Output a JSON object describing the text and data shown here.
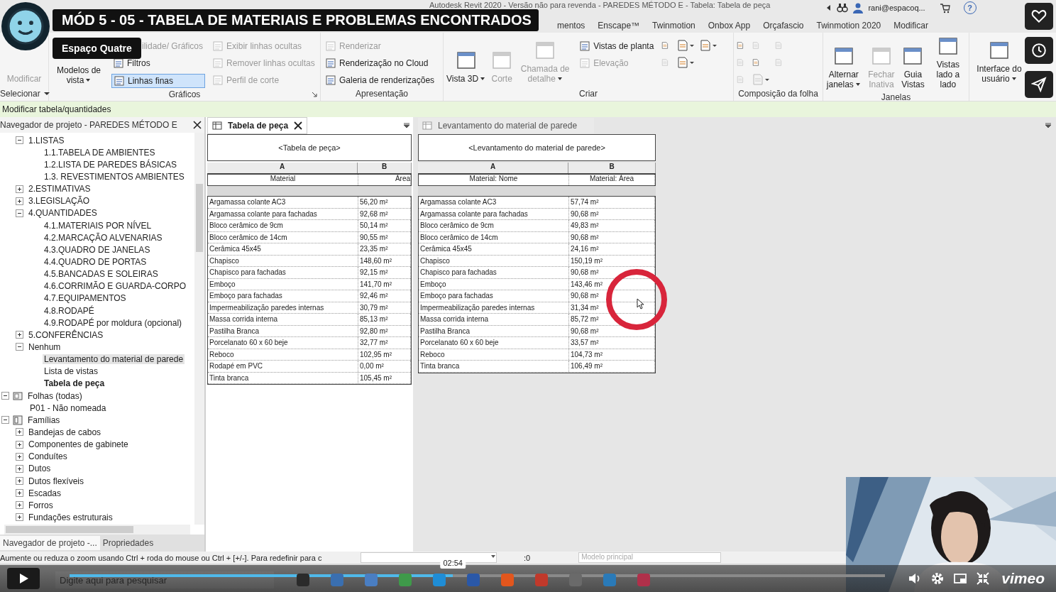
{
  "overlay": {
    "title": "MÓD 5 - 05 - TABELA DE MATERIAIS E PROBLEMAS ENCONTRADOS",
    "channel": "Espaço Quatre"
  },
  "window": {
    "title": "Autodesk Revit 2020 - Versão não para revenda - PAREDES MÉTODO E - Tabela: Tabela de peça",
    "user": "rani@espacoq...",
    "help": "?"
  },
  "ribbon": {
    "tabs": [
      {
        "label": "mentos",
        "selected": false
      },
      {
        "label": "Enscape™",
        "selected": false
      },
      {
        "label": "Twinmotion",
        "selected": false
      },
      {
        "label": "Onbox App",
        "selected": false
      },
      {
        "label": "Orçafascio",
        "selected": false
      },
      {
        "label": "Twinmotion 2020",
        "selected": false
      },
      {
        "label": "Modificar",
        "selected": false
      }
    ],
    "panels": [
      {
        "label": "Selecionar",
        "dropdown": true,
        "tools": [
          {
            "kind": "large",
            "label": "Modificar",
            "disabled": true,
            "dropdown": false,
            "icon": false
          }
        ]
      },
      {
        "label": "Gráficos",
        "launcher": true,
        "tools": [
          {
            "kind": "large",
            "label": "Modelos de vista",
            "disabled": false,
            "dropdown": true,
            "icon": false
          },
          {
            "kind": "stack",
            "items": [
              {
                "label": "ilidade/ Gráficos",
                "disabled": true,
                "on": false
              },
              {
                "label": "Filtros",
                "disabled": false,
                "on": false
              },
              {
                "label": "Linhas finas",
                "disabled": false,
                "on": true
              }
            ]
          },
          {
            "kind": "stack",
            "items": [
              {
                "label": "Exibir linhas ocultas",
                "disabled": true
              },
              {
                "label": "Remover linhas ocultas",
                "disabled": true
              },
              {
                "label": "Perfil de corte",
                "disabled": true
              }
            ]
          }
        ]
      },
      {
        "label": "Apresentação",
        "tools": [
          {
            "kind": "stack",
            "items": [
              {
                "label": "Renderizar",
                "disabled": true
              },
              {
                "label": "Renderização no Cloud",
                "disabled": false
              },
              {
                "label": "Galeria de renderizações",
                "disabled": false
              }
            ]
          }
        ]
      },
      {
        "label": "Criar",
        "tools": [
          {
            "kind": "large",
            "label": "Vista 3D",
            "disabled": false,
            "dropdown": true,
            "icon": true
          },
          {
            "kind": "large",
            "label": "Corte",
            "disabled": true,
            "dropdown": false,
            "icon": true
          },
          {
            "kind": "large",
            "label": "Chamada de detalhe",
            "disabled": true,
            "dropdown": true,
            "icon": true
          },
          {
            "kind": "stack",
            "items": [
              {
                "label": "Vistas de planta",
                "disabled": false
              },
              {
                "label": "Elevação",
                "disabled": true
              }
            ]
          },
          {
            "kind": "icons",
            "icons": [
              {
                "disabled": false,
                "dropdown": false
              },
              {
                "disabled": false,
                "dropdown": true
              },
              {
                "disabled": false,
                "dropdown": true
              },
              {
                "disabled": true,
                "dropdown": false
              },
              {
                "disabled": false,
                "dropdown": true
              }
            ]
          }
        ]
      },
      {
        "label": "Composição da folha",
        "tools": [
          {
            "kind": "icons",
            "icons": [
              {
                "disabled": false,
                "dropdown": false
              },
              {
                "disabled": true,
                "dropdown": false
              },
              {
                "disabled": true,
                "dropdown": false
              },
              {
                "disabled": true,
                "dropdown": false
              },
              {
                "disabled": false,
                "dropdown": false
              },
              {
                "disabled": true,
                "dropdown": false
              },
              {
                "disabled": true,
                "dropdown": false
              },
              {
                "disabled": true,
                "dropdown": true
              }
            ]
          }
        ]
      },
      {
        "label": "Janelas",
        "tools": [
          {
            "kind": "large",
            "label": "Alternar janelas",
            "disabled": false,
            "dropdown": true,
            "icon": true
          },
          {
            "kind": "large",
            "label": "Fechar Inativa",
            "disabled": true,
            "dropdown": false,
            "icon": true
          },
          {
            "kind": "large",
            "label": "Guia Vistas",
            "disabled": false,
            "dropdown": false,
            "icon": true
          },
          {
            "kind": "large",
            "label": "Vistas lado a lado",
            "disabled": false,
            "dropdown": false,
            "icon": true
          }
        ]
      },
      {
        "tools": [
          {
            "kind": "large",
            "label": "Interface do usuário",
            "disabled": false,
            "dropdown": true,
            "icon": true
          }
        ]
      }
    ]
  },
  "options_bar": "Modificar tabela/quantidades",
  "browser": {
    "title": "Navegador de projeto - PAREDES MÉTODO E",
    "schedules": [
      {
        "label": "1.LISTAS",
        "expanded": true,
        "selected": false,
        "current": false,
        "children": [
          {
            "label": "1.1.TABELA DE AMBIENTES",
            "selected": false,
            "current": false
          },
          {
            "label": "1.2.LISTA DE PAREDES BÁSICAS",
            "selected": false,
            "current": false
          },
          {
            "label": "1.3. REVESTIMENTOS AMBIENTES",
            "selected": false,
            "current": false
          }
        ]
      },
      {
        "label": "2.ESTIMATIVAS",
        "expanded": false,
        "selected": false,
        "current": false
      },
      {
        "label": "3.LEGISLAÇÃO",
        "expanded": false,
        "selected": false,
        "current": false
      },
      {
        "label": "4.QUANTIDADES",
        "expanded": true,
        "selected": false,
        "current": false,
        "children": [
          {
            "label": "4.1.MATERIAIS POR NÍVEL",
            "selected": false,
            "current": false
          },
          {
            "label": "4.2.MARCAÇÃO ALVENARIAS",
            "selected": false,
            "current": false
          },
          {
            "label": "4.3.QUADRO DE JANELAS",
            "selected": false,
            "current": false
          },
          {
            "label": "4.4.QUADRO DE PORTAS",
            "selected": false,
            "current": false
          },
          {
            "label": "4.5.BANCADAS E SOLEIRAS",
            "selected": false,
            "current": false
          },
          {
            "label": "4.6.CORRIMÃO E GUARDA-CORPO",
            "selected": false,
            "current": false
          },
          {
            "label": "4.7.EQUIPAMENTOS",
            "selected": false,
            "current": false
          },
          {
            "label": "4.8.RODAPÉ",
            "selected": false,
            "current": false
          },
          {
            "label": "4.9.RODAPÉ por moldura (opcional)",
            "selected": false,
            "current": false
          }
        ]
      },
      {
        "label": "5.CONFERÊNCIAS",
        "expanded": false,
        "selected": false,
        "current": false
      },
      {
        "label": "Nenhum",
        "expanded": true,
        "selected": false,
        "current": false,
        "children": [
          {
            "label": "Levantamento do material de parede",
            "selected": true,
            "current": false
          },
          {
            "label": "Lista de vistas",
            "selected": false,
            "current": false
          },
          {
            "label": "Tabela de peça",
            "selected": false,
            "current": true
          }
        ]
      }
    ],
    "categories": [
      {
        "label": "Folhas (todas)",
        "kind": "sheets",
        "expanded": true,
        "selected": false,
        "current": false,
        "children": [
          {
            "label": "P01 - Não nomeada",
            "selected": false,
            "current": false
          }
        ]
      },
      {
        "label": "Famílias",
        "kind": "families",
        "expanded": true,
        "selected": false,
        "current": false,
        "children": [
          {
            "label": "Bandejas de cabos",
            "expanded": false,
            "selected": false,
            "current": false
          },
          {
            "label": "Componentes de gabinete",
            "expanded": false,
            "selected": false,
            "current": false
          },
          {
            "label": "Conduítes",
            "expanded": false,
            "selected": false,
            "current": false
          },
          {
            "label": "Dutos",
            "expanded": false,
            "selected": false,
            "current": false
          },
          {
            "label": "Dutos flexíveis",
            "expanded": false,
            "selected": false,
            "current": false
          },
          {
            "label": "Escadas",
            "expanded": false,
            "selected": false,
            "current": false
          },
          {
            "label": "Forros",
            "expanded": false,
            "selected": false,
            "current": false
          },
          {
            "label": "Fundações estruturais",
            "expanded": false,
            "selected": false,
            "current": false
          }
        ]
      }
    ],
    "bottom_tabs": [
      {
        "label": "Navegador de projeto -...",
        "selected": true
      },
      {
        "label": "Propriedades",
        "selected": false
      }
    ]
  },
  "views": [
    {
      "tab": "Tabela de peça",
      "active": true,
      "closable": true,
      "table": {
        "title": "<Tabela de peça>",
        "letters": [
          "A",
          "B"
        ],
        "headers": [
          "Material",
          "Área"
        ],
        "rows": [
          [
            "Argamassa colante AC3",
            "56,20 m²"
          ],
          [
            "Argamassa colante para fachadas",
            "92,68 m²"
          ],
          [
            "Bloco cerâmico de 9cm",
            "50,14 m²"
          ],
          [
            "Bloco cerâmico de 14cm",
            "90,55 m²"
          ],
          [
            "Cerâmica 45x45",
            "23,35 m²"
          ],
          [
            "Chapisco",
            "148,60 m²"
          ],
          [
            "Chapisco para fachadas",
            "92,15 m²"
          ],
          [
            "Emboço",
            "141,70 m²"
          ],
          [
            "Emboço para fachadas",
            "92,46 m²"
          ],
          [
            "Impermeabilização paredes internas",
            "30,79 m²"
          ],
          [
            "Massa corrida interna",
            "85,13 m²"
          ],
          [
            "Pastilha Branca",
            "92,80 m²"
          ],
          [
            "Porcelanato 60 x 60 beje",
            "32,77 m²"
          ],
          [
            "Reboco",
            "102,95 m²"
          ],
          [
            "Rodapé em PVC",
            "0,00 m²"
          ],
          [
            "Tinta branca",
            "105,45 m²"
          ]
        ]
      }
    },
    {
      "tab": "Levantamento do material de parede",
      "active": false,
      "closable": false,
      "table": {
        "title": "<Levantamento do material de parede>",
        "letters": [
          "A",
          "B"
        ],
        "headers": [
          "Material: Nome",
          "Material: Área"
        ],
        "rows": [
          [
            "Argamassa colante AC3",
            "57,74 m²"
          ],
          [
            "Argamassa colante para fachadas",
            "90,68 m²"
          ],
          [
            "Bloco cerâmico de 9cm",
            "49,83 m²"
          ],
          [
            "Bloco cerâmico de 14cm",
            "90,68 m²"
          ],
          [
            "Cerâmica 45x45",
            "24,16 m²"
          ],
          [
            "Chapisco",
            "150,19 m²"
          ],
          [
            "Chapisco para fachadas",
            "90,68 m²"
          ],
          [
            "Emboço",
            "143,46 m²"
          ],
          [
            "Emboço para fachadas",
            "90,68 m²"
          ],
          [
            "Impermeabilização paredes internas",
            "31,34 m²"
          ],
          [
            "Massa corrida interna",
            "85,72 m²"
          ],
          [
            "Pastilha Branca",
            "90,68 m²"
          ],
          [
            "Porcelanato 60 x 60 beje",
            "33,57 m²"
          ],
          [
            "Reboco",
            "104,73 m²"
          ],
          [
            "Tinta branca",
            "106,49 m²"
          ]
        ]
      }
    }
  ],
  "status_bar": {
    "text": "Aumente ou reduza o zoom usando Ctrl + roda do mouse ou Ctrl + [+/-]. Para redefinir para c",
    "counter": ":0",
    "model": "Modelo principal"
  },
  "taskbar": {
    "search_placeholder": "Digite aqui para pesquisar",
    "apps": [
      {
        "color": "#2b2b2b"
      },
      {
        "color": "#3a6fb0"
      },
      {
        "color": "#4a7ec2"
      },
      {
        "color": "#3f9a4a"
      },
      {
        "color": "#1f8dd6"
      },
      {
        "color": "#2a58a8"
      },
      {
        "color": "#e2561d"
      },
      {
        "color": "#c0392b"
      },
      {
        "color": "#6a6a6a"
      },
      {
        "color": "#2a7ab8"
      },
      {
        "color": "#b0304a"
      }
    ]
  },
  "player": {
    "time": "02:54",
    "level": 0.47,
    "logo": "vimeo"
  }
}
